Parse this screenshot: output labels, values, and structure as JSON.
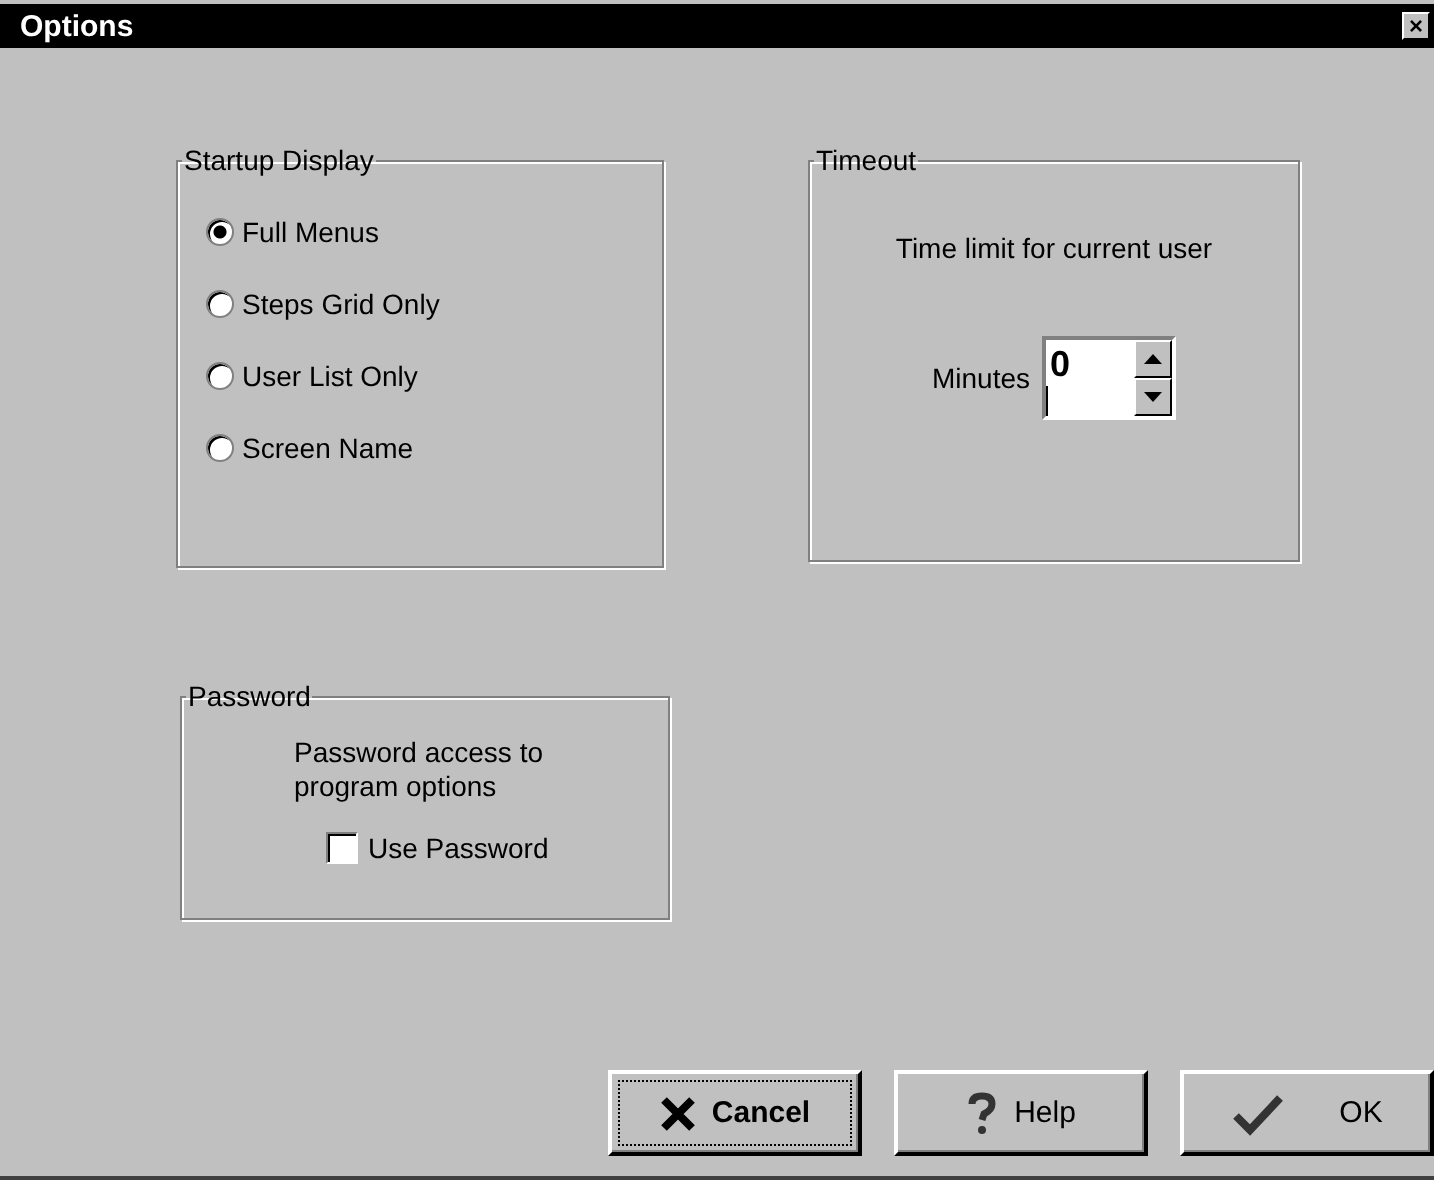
{
  "window": {
    "title": "Options",
    "close": "×"
  },
  "startup_display": {
    "title": "Startup Display",
    "options": [
      {
        "label": "Full Menus",
        "selected": true
      },
      {
        "label": "Steps Grid Only",
        "selected": false
      },
      {
        "label": "User List Only",
        "selected": false
      },
      {
        "label": "Screen Name",
        "selected": false
      }
    ]
  },
  "timeout": {
    "title": "Timeout",
    "description": "Time limit for current user",
    "minutes_label": "Minutes",
    "minutes_value": "0"
  },
  "password": {
    "title": "Password",
    "description": "Password access to program options",
    "use_password": {
      "label": "Use Password",
      "checked": false
    }
  },
  "buttons": [
    {
      "kind": "cancel",
      "label": "Cancel",
      "focused": true
    },
    {
      "kind": "help",
      "label": "Help",
      "focused": false
    },
    {
      "kind": "ok",
      "label": "OK",
      "focused": false
    }
  ]
}
